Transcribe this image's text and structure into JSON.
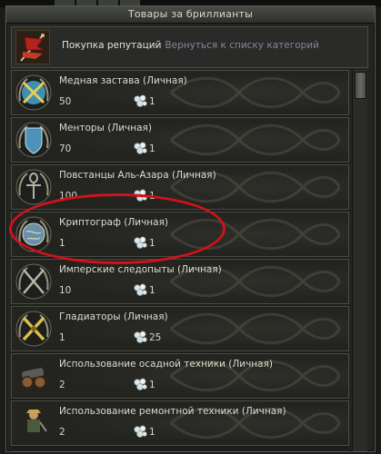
{
  "window": {
    "title": "Товары за бриллианты"
  },
  "header": {
    "label": "Покупка репутаций",
    "link": "Вернуться к списку категорий",
    "icon": "banner-flag-icon"
  },
  "items": [
    {
      "name": "Медная застава (Личная)",
      "price": "50",
      "qty": "1",
      "emblem": "crossed-swords-shield-icon",
      "color": "#3f8fb2"
    },
    {
      "name": "Менторы (Личная)",
      "price": "70",
      "qty": "1",
      "emblem": "blue-shield-icon",
      "color": "#4d92b8"
    },
    {
      "name": "Повстанцы Аль-Азара (Личная)",
      "price": "100",
      "qty": "1",
      "emblem": "ankh-icon",
      "color": "#b0b0a4"
    },
    {
      "name": "Криптограф (Личная)",
      "price": "1",
      "qty": "1",
      "emblem": "globe-icon",
      "color": "#6a8fa8"
    },
    {
      "name": "Имперские следопыты (Личная)",
      "price": "10",
      "qty": "1",
      "emblem": "crossed-blades-icon",
      "color": "#b8b8aa"
    },
    {
      "name": "Гладиаторы (Личная)",
      "price": "1",
      "qty": "25",
      "emblem": "golden-swords-icon",
      "color": "#d9c04a"
    },
    {
      "name": "Использование осадной техники (Личная)",
      "price": "2",
      "qty": "1",
      "emblem": "cannon-icon",
      "color": "#8a5a34"
    },
    {
      "name": "Использование ремонтной техники (Личная)",
      "price": "2",
      "qty": "1",
      "emblem": "engineer-icon",
      "color": "#c9a64a"
    }
  ],
  "currency_icon": "diamond-gem-icon",
  "highlight_color": "#d0121b"
}
